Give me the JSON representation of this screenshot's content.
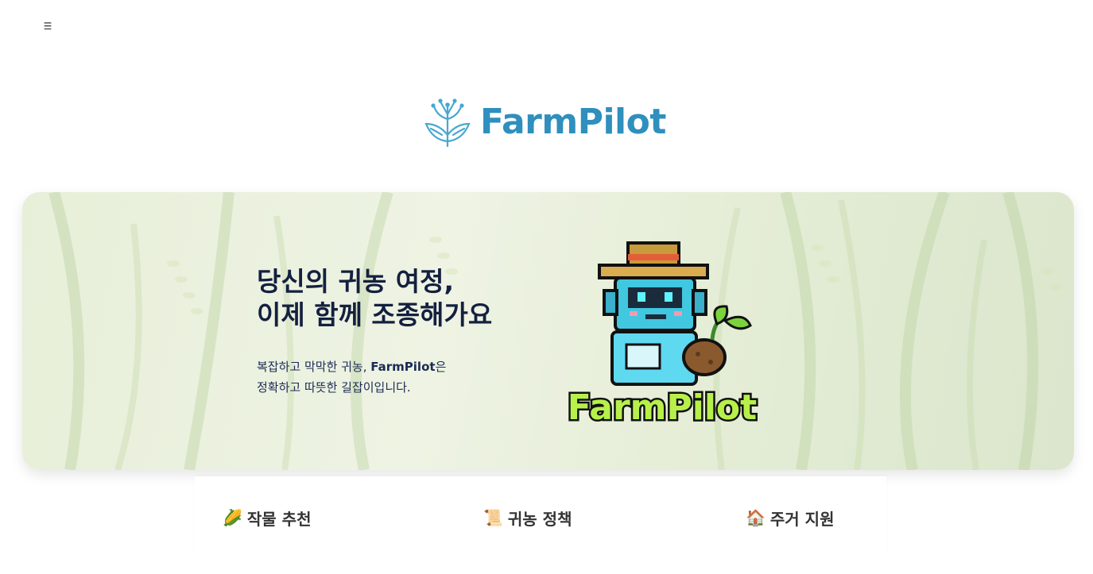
{
  "header": {
    "menu_icon": "☰",
    "logo_text": "FarmPilot",
    "brand_color": "#2f8fbd"
  },
  "hero": {
    "title_line1": "당신의 귀농 여정,",
    "title_line2": "이제 함께 조종해가요",
    "desc_line1_before": "복잡하고 막막한 귀농, ",
    "desc_line1_brand": "FarmPilot",
    "desc_line1_after": "은",
    "desc_line2": "정확하고 따뜻한 길잡이입니다.",
    "mascot_text": "FarmPilot"
  },
  "tabs": [
    {
      "icon": "🌽",
      "label": "작물 추천"
    },
    {
      "icon": "📜",
      "label": "귀농 정책"
    },
    {
      "icon": "🏠",
      "label": "주거 지원"
    }
  ]
}
